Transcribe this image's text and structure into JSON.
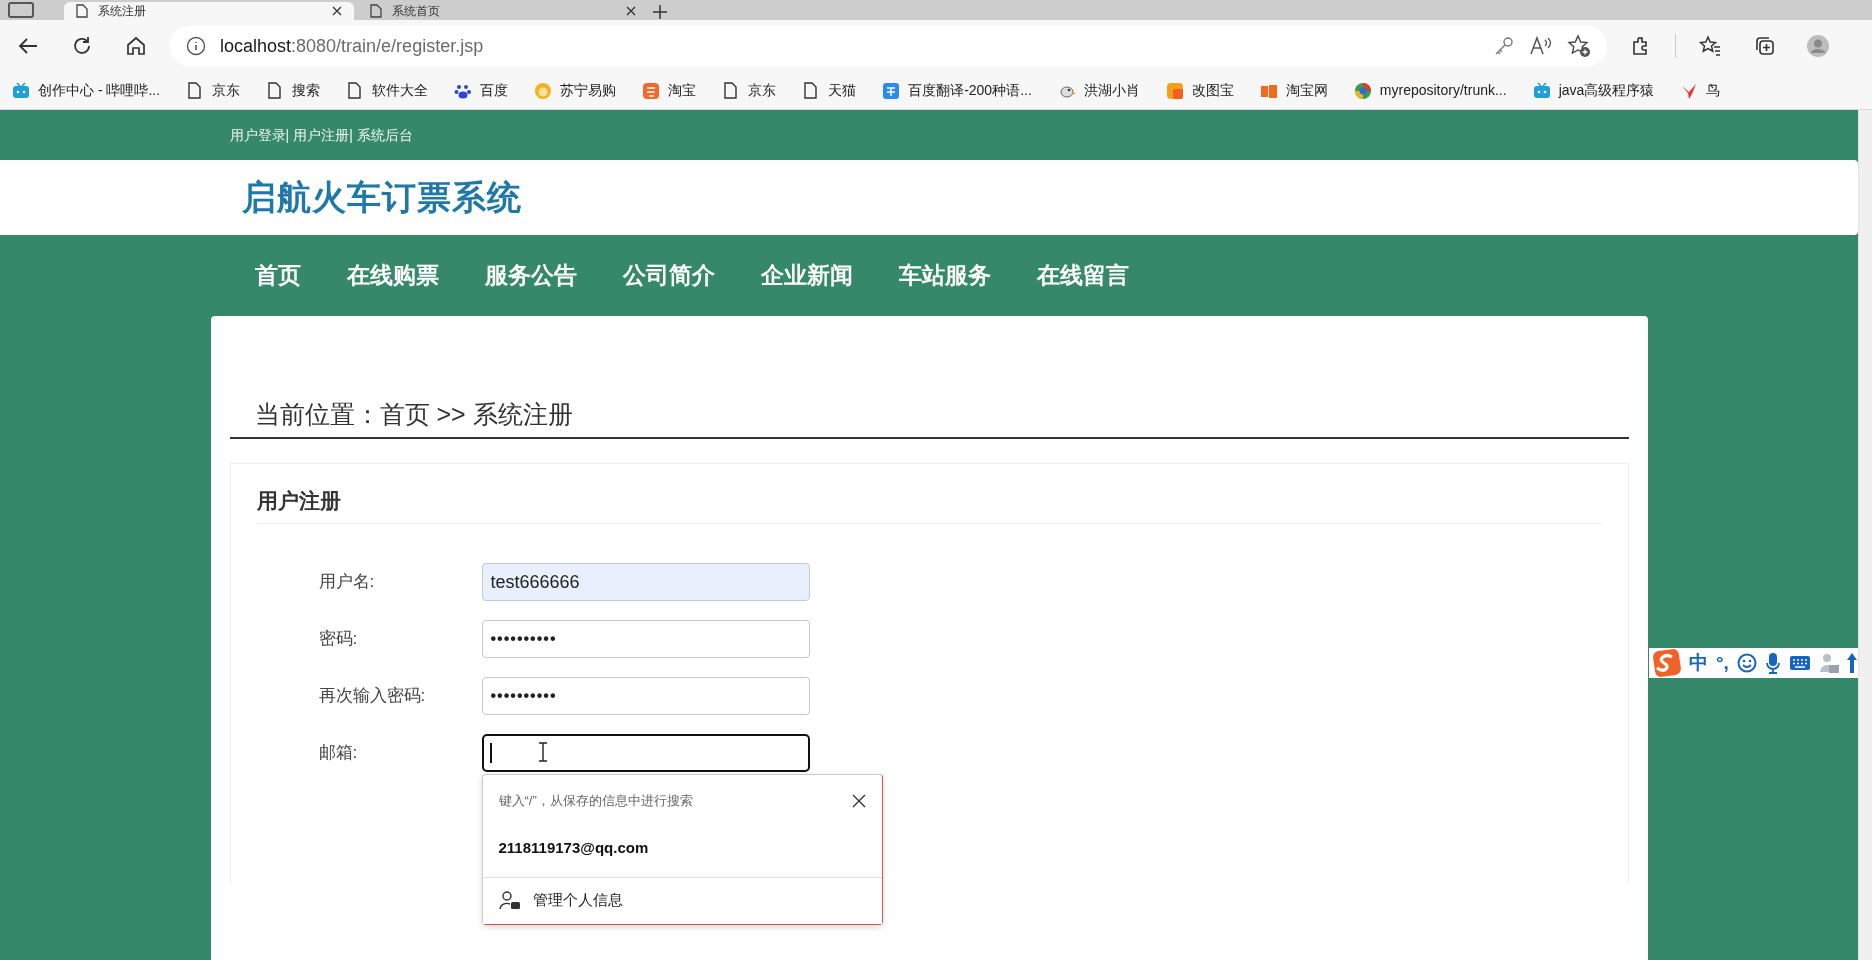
{
  "browser": {
    "tabs": [
      {
        "title": "系统注册",
        "selected": true
      },
      {
        "title": "系统首页",
        "selected": false
      }
    ],
    "address": {
      "host": "localhost",
      "path": ":8080/train/e/register.jsp"
    },
    "bookmarks": [
      {
        "label": "创作中心 - 哔哩哔..."
      },
      {
        "label": "京东"
      },
      {
        "label": "搜索"
      },
      {
        "label": "软件大全"
      },
      {
        "label": "百度"
      },
      {
        "label": "苏宁易购"
      },
      {
        "label": "淘宝"
      },
      {
        "label": "京东"
      },
      {
        "label": "天猫"
      },
      {
        "label": "百度翻译-200种语..."
      },
      {
        "label": "洪湖小肖"
      },
      {
        "label": "改图宝"
      },
      {
        "label": "淘宝网"
      },
      {
        "label": "myrepository/trunk..."
      },
      {
        "label": "java高级程序猿"
      },
      {
        "label": "鸟"
      }
    ]
  },
  "page": {
    "top_links": [
      "用户登录|",
      "用户注册|",
      "系统后台"
    ],
    "site_title": "启航火车订票系统",
    "nav": [
      "首页",
      "在线购票",
      "服务公告",
      "公司简介",
      "企业新闻",
      "车站服务",
      "在线留言"
    ],
    "breadcrumb": "当前位置：首页 >> 系统注册",
    "form": {
      "title": "用户注册",
      "fields": [
        {
          "label": "用户名:",
          "kind": "text",
          "value": "test666666",
          "autofilled": true,
          "focused": false
        },
        {
          "label": "密码:",
          "kind": "password",
          "value": "••••••••••",
          "autofilled": false,
          "focused": false
        },
        {
          "label": "再次输入密码:",
          "kind": "password",
          "value": "••••••••••",
          "autofilled": false,
          "focused": false
        },
        {
          "label": "邮箱:",
          "kind": "text",
          "autofilled": false,
          "focused": true
        }
      ]
    },
    "autofill": {
      "hint": "键入“/”，从保存的信息中进行搜索",
      "suggestion": "2118119173@qq.com",
      "manage": "管理个人信息"
    }
  },
  "ime": {
    "mode": "中",
    "punctuation": "°,"
  }
}
